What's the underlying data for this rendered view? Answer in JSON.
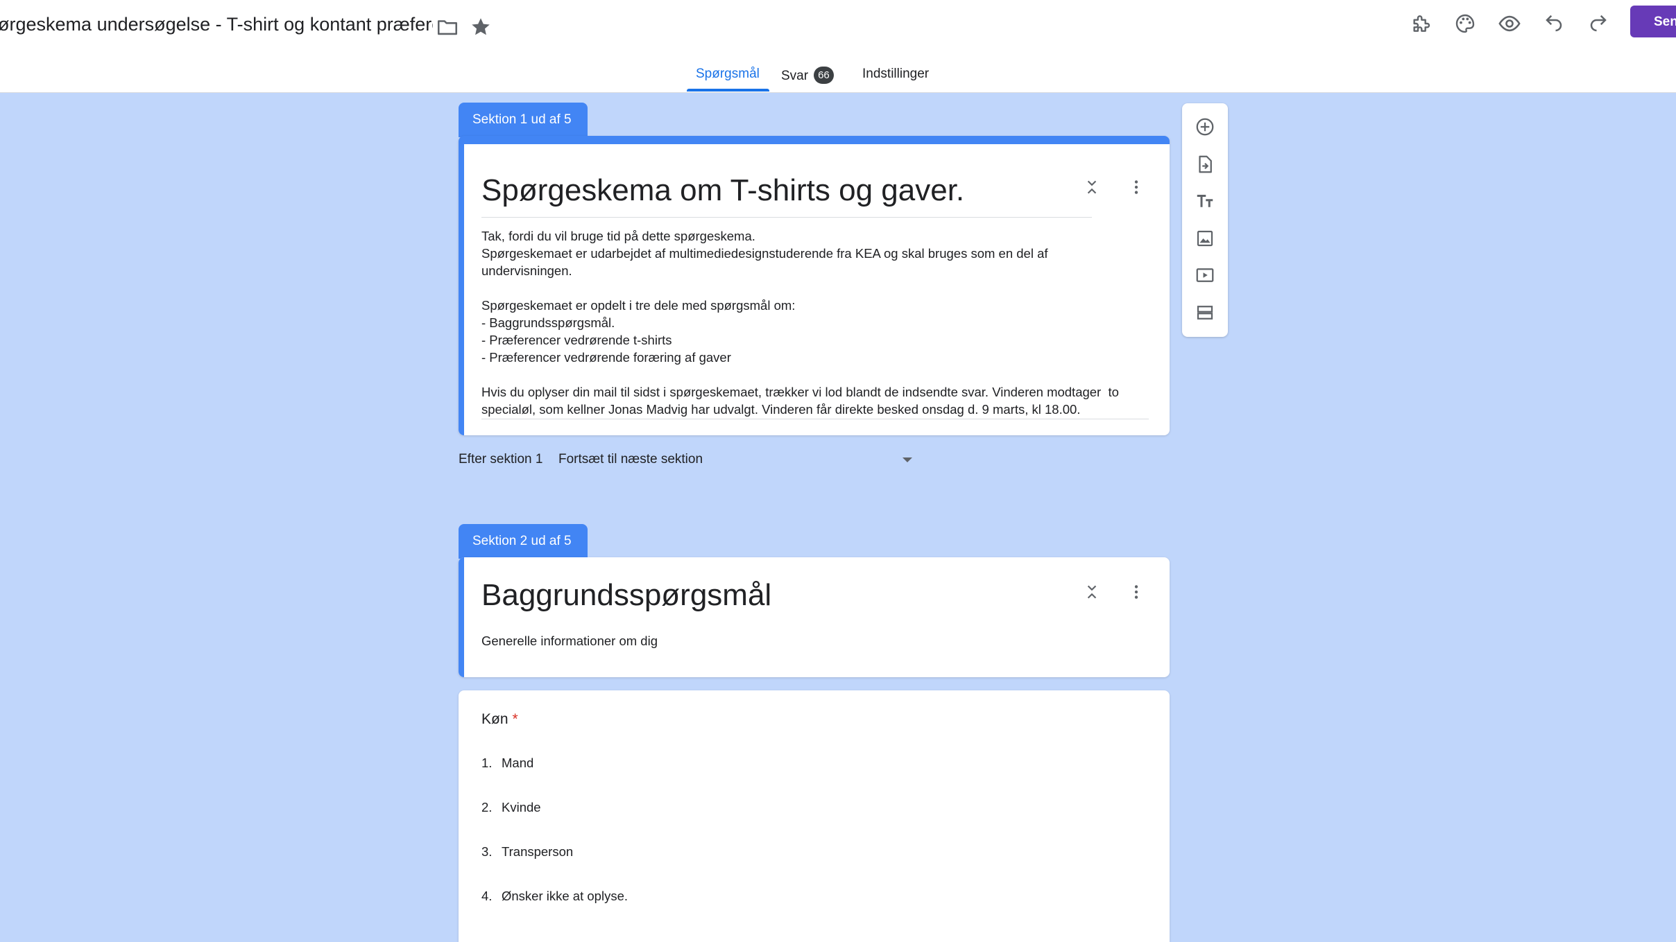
{
  "header": {
    "doc_title": "Spørgeskema undersøgelse - T-shirt og kontant præference",
    "folder_icon": "folder-icon",
    "star_icon": "star-icon",
    "icons": [
      "addon-icon",
      "palette-icon",
      "preview-icon",
      "undo-icon",
      "redo-icon"
    ],
    "send_label": "Send",
    "accent": "#673ab7"
  },
  "tabs": {
    "questions": "Spørgsmål",
    "responses": "Svar",
    "responses_count": "66",
    "settings": "Indstillinger"
  },
  "section1": {
    "tab_label": "Sektion 1 ud af 5",
    "title": "Spørgeskema om T-shirts og gaver.",
    "description": [
      "Tak, fordi du vil bruge tid på dette spørgeskema.",
      "Spørgeskemaet er udarbejdet af multimediedesignstuderende fra KEA og skal bruges som en del af",
      "undervisningen.",
      "",
      "Spørgeskemaet er opdelt i tre dele med spørgsmål om:",
      "- Baggrundsspørgsmål.",
      "- Præferencer vedrørende t-shirts",
      "- Præferencer vedrørende foræring af gaver",
      "",
      "Hvis du oplyser din mail til sidst i spørgeskemaet, trækker vi lod blandt de indsendte svar. Vinderen modtager  to",
      "specialøl, som kellner Jonas Madvig har udvalgt. Vinderen får direkte besked onsdag d. 9 marts, kl 18.00."
    ],
    "after_label": "Efter sektion 1",
    "after_value": "Fortsæt til næste sektion"
  },
  "section2": {
    "tab_label": "Sektion 2 ud af 5",
    "title": "Baggrundsspørgsmål",
    "description": "Generelle informationer om dig"
  },
  "question": {
    "title": "Køn",
    "required_mark": "*",
    "options": [
      {
        "num": "1.",
        "label": "Mand"
      },
      {
        "num": "2.",
        "label": "Kvinde"
      },
      {
        "num": "3.",
        "label": "Transperson"
      },
      {
        "num": "4.",
        "label": "Ønsker ikke at oplyse."
      }
    ]
  },
  "side_toolbar": [
    "add-question-icon",
    "import-questions-icon",
    "add-title-icon",
    "add-image-icon",
    "add-video-icon",
    "add-section-icon"
  ],
  "colors": {
    "background": "#c0d6fb",
    "section_blue": "#4285f4",
    "tab_blue": "#1a73e8",
    "required_red": "#d93025"
  }
}
